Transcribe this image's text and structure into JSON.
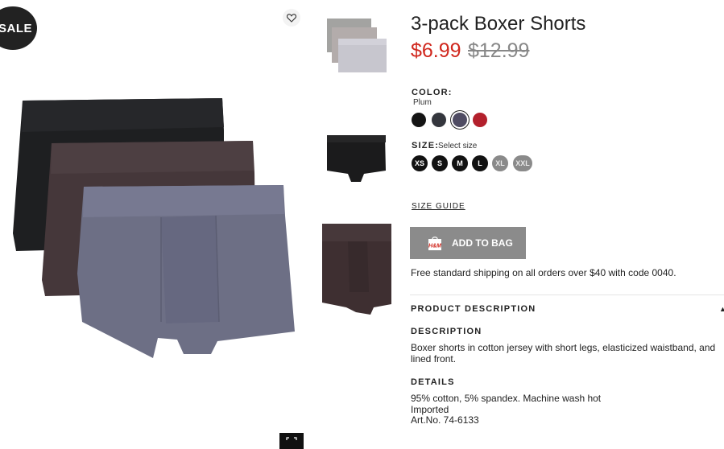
{
  "badge": {
    "sale_label": "SALE"
  },
  "product": {
    "title": "3-pack Boxer Shorts",
    "sale_price": "$6.99",
    "original_price": "$12.99"
  },
  "color": {
    "label": "COLOR:",
    "selected_name": "Plum",
    "swatches": [
      {
        "name": "Black",
        "hex": "#141414"
      },
      {
        "name": "Dark gray",
        "hex": "#34363d"
      },
      {
        "name": "Plum",
        "hex": "#4f4c63"
      },
      {
        "name": "Red",
        "hex": "#b3202c"
      }
    ]
  },
  "size": {
    "label": "SIZE:",
    "hint": "Select size",
    "options": [
      {
        "label": "XS",
        "available": true
      },
      {
        "label": "S",
        "available": true
      },
      {
        "label": "M",
        "available": true
      },
      {
        "label": "L",
        "available": true
      },
      {
        "label": "XL",
        "available": false
      },
      {
        "label": "XXL",
        "available": false
      }
    ]
  },
  "size_guide": "SIZE GUIDE",
  "add_to_bag": {
    "label": "ADD TO BAG",
    "logo_text": "H&M"
  },
  "shipping_note": "Free standard shipping on all orders over $40 with code 0040.",
  "product_description": {
    "heading": "PRODUCT DESCRIPTION",
    "description_heading": "DESCRIPTION",
    "description_text": "Boxer shorts in cotton jersey with short legs, elasticized waistband, and lined front.",
    "details_heading": "DETAILS",
    "details_lines": [
      "95% cotton, 5% spandex. Machine wash hot",
      "Imported",
      "Art.No. 74-6133"
    ]
  },
  "colors": {
    "sale_red": "#d0271d",
    "button_gray": "#8b8b8b"
  },
  "icons": {
    "favorite": "heart-icon",
    "expand": "expand-icon",
    "collapse": "caret-up-icon"
  }
}
